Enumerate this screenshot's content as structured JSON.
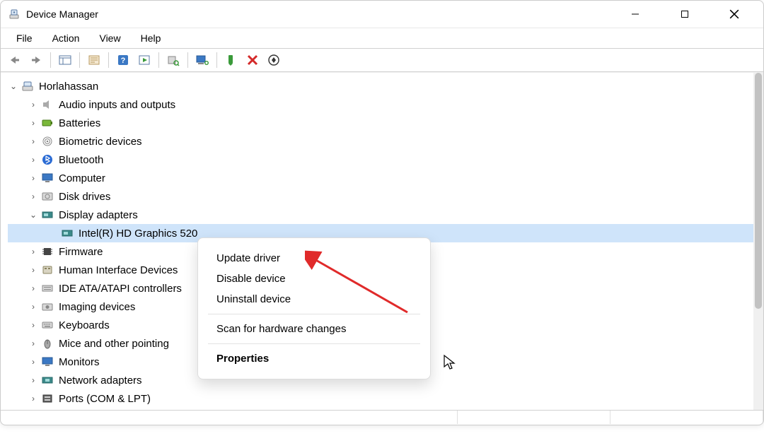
{
  "window": {
    "title": "Device Manager"
  },
  "menu": {
    "file": "File",
    "action": "Action",
    "view": "View",
    "help": "Help"
  },
  "toolbar_icons": {
    "back": "back-arrow-icon",
    "forward": "forward-arrow-icon",
    "show_hidden": "show-hidden-icon",
    "properties": "properties-icon",
    "help": "help-icon",
    "action": "action-icon",
    "scan": "scan-hardware-icon",
    "monitor": "monitor-add-icon",
    "enable": "enable-device-icon",
    "disable": "disable-device-icon",
    "update_hw": "update-hw-icon"
  },
  "tree": {
    "root": "Horlahassan",
    "items": [
      {
        "label": "Audio inputs and outputs"
      },
      {
        "label": "Batteries"
      },
      {
        "label": "Biometric devices"
      },
      {
        "label": "Bluetooth"
      },
      {
        "label": "Computer"
      },
      {
        "label": "Disk drives"
      },
      {
        "label": "Display adapters",
        "expanded": true,
        "children": [
          {
            "label": "Intel(R) HD Graphics 520",
            "selected": true
          }
        ]
      },
      {
        "label": "Firmware"
      },
      {
        "label": "Human Interface Devices"
      },
      {
        "label": "IDE ATA/ATAPI controllers"
      },
      {
        "label": "Imaging devices"
      },
      {
        "label": "Keyboards"
      },
      {
        "label": "Mice and other pointing"
      },
      {
        "label": "Monitors"
      },
      {
        "label": "Network adapters"
      },
      {
        "label": "Ports (COM & LPT)"
      }
    ]
  },
  "context_menu": {
    "update": "Update driver",
    "disable": "Disable device",
    "uninstall": "Uninstall device",
    "scan": "Scan for hardware changes",
    "properties": "Properties"
  }
}
